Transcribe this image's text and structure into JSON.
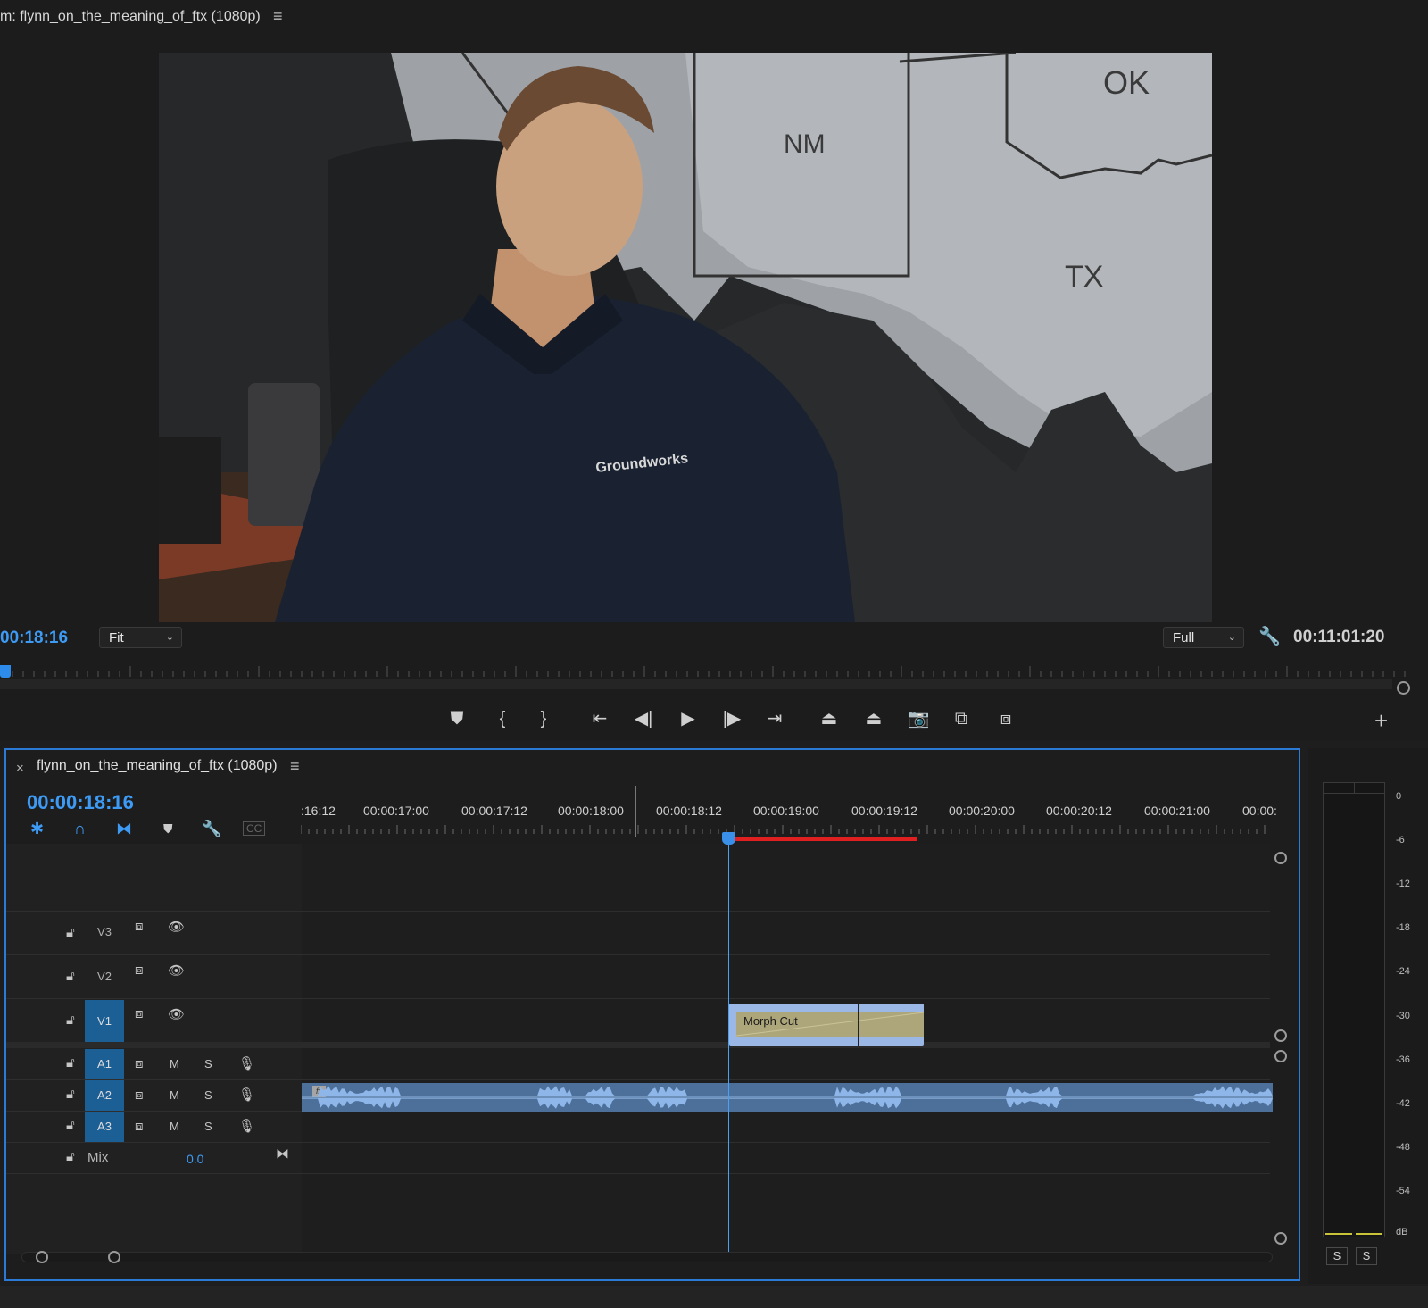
{
  "program_monitor": {
    "title": "m: flynn_on_the_meaning_of_ftx (1080p)",
    "timecode": "00:18:16",
    "zoom_value": "Fit",
    "quality_value": "Full",
    "duration": "00:11:01:20",
    "frame_labels": {
      "state1": "NM",
      "state2": "OK",
      "state3": "TX",
      "shirt_logo": "Groundworks"
    }
  },
  "transport": {
    "buttons": [
      "add-marker",
      "mark-in",
      "mark-out",
      "go-to-in",
      "step-back",
      "play",
      "step-forward",
      "go-to-out",
      "lift",
      "extract",
      "export-frame",
      "insert",
      "overwrite"
    ],
    "add_label": "+"
  },
  "timeline": {
    "close": "×",
    "title": "flynn_on_the_meaning_of_ftx (1080p)",
    "timecode": "00:00:18:16",
    "ruler_labels": [
      ":16:12",
      "00:00:17:00",
      "00:00:17:12",
      "00:00:18:00",
      "00:00:18:12",
      "00:00:19:00",
      "00:00:19:12",
      "00:00:20:00",
      "00:00:20:12",
      "00:00:21:00",
      "00:00:"
    ],
    "video_tracks": [
      "V3",
      "V2",
      "V1"
    ],
    "audio_tracks": [
      "A1",
      "A2",
      "A3"
    ],
    "mute_label": "M",
    "solo_label": "S",
    "mix_label": "Mix",
    "mix_value": "0.0",
    "clip_morph_label": "Morph Cut",
    "fx_badge": "fx",
    "cc_label": "CC"
  },
  "meter": {
    "labels": [
      "0",
      "-6",
      "-12",
      "-18",
      "-24",
      "-30",
      "-36",
      "-42",
      "-48",
      "-54",
      "dB"
    ],
    "solo_left": "S",
    "solo_right": "S"
  },
  "colors": {
    "accent": "#3d9bf5",
    "track_active": "#1c5f95",
    "work_area": "#e02020",
    "clip_video": "#9ab7e6",
    "clip_audio": "#4c709a"
  }
}
